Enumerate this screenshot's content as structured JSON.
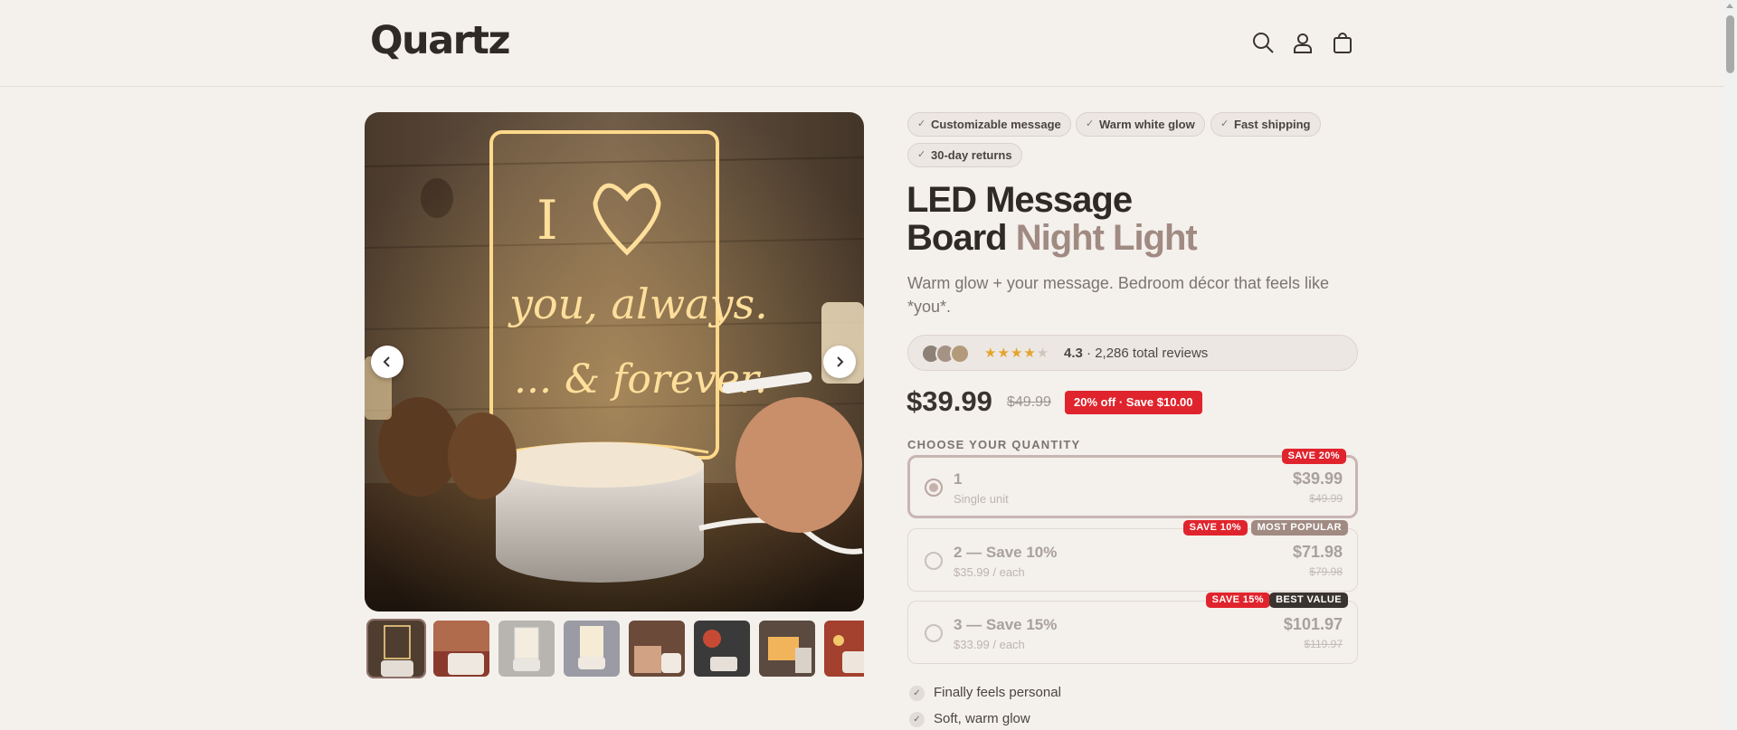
{
  "brand": {
    "logo": "Quartz"
  },
  "header": {
    "icons": [
      "search-icon",
      "account-icon",
      "cart-icon"
    ]
  },
  "gallery": {
    "main_image_text": {
      "line1": "I",
      "line2": "you, always.",
      "line3": "... & forever."
    },
    "thumbnail_count": 8,
    "active_thumbnail": 1
  },
  "badges": [
    "Customizable message",
    "Warm white glow",
    "Fast shipping",
    "30-day returns"
  ],
  "product": {
    "title_line1": "LED Message",
    "title_line2_a": "Board",
    "title_line2_b": "Night Light",
    "subtitle": "Warm glow + your message. Bedroom décor that feels like *you*."
  },
  "reviews": {
    "stars": "★★★★",
    "half_star": "★",
    "rating": "4.3",
    "separator": " · ",
    "count_text": "2,286 total reviews"
  },
  "pricing": {
    "price": "$39.99",
    "compare_at": "$49.99",
    "save_tag": "20% off · Save $10.00"
  },
  "quantity": {
    "label": "CHOOSE YOUR QUANTITY",
    "options": [
      {
        "title": "1",
        "sub": "Single unit",
        "price": "$39.99",
        "old": "$49.99",
        "tags": [
          "SAVE 20%"
        ],
        "selected": true
      },
      {
        "title": "2 — Save 10%",
        "sub": "$35.99 / each",
        "price": "$71.98",
        "old": "$79.98",
        "tags": [
          "SAVE 10%",
          "MOST POPULAR"
        ],
        "selected": false
      },
      {
        "title": "3 — Save 15%",
        "sub": "$33.99 / each",
        "price": "$101.97",
        "old": "$119.97",
        "tags": [
          "SAVE 15%",
          "BEST VALUE"
        ],
        "selected": false
      }
    ]
  },
  "benefits": [
    "Finally feels personal",
    "Soft, warm glow"
  ],
  "check_glyph": "✓",
  "colors": {
    "background": "#f4f0ec",
    "accent_mauve": "#a08a82",
    "sale_red": "#e0242d",
    "dark": "#3a3430",
    "star": "#e5a42c"
  }
}
